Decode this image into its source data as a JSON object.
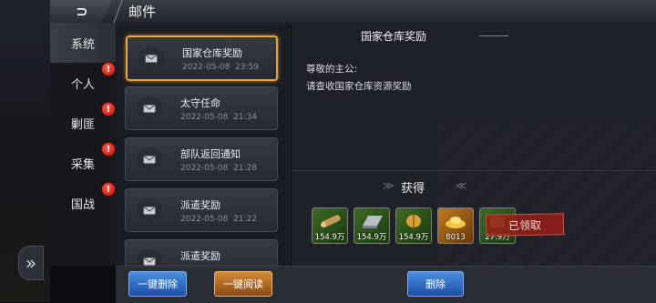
{
  "window": {
    "title": "邮件"
  },
  "tabs": [
    {
      "label": "系统",
      "active": true,
      "alert": false
    },
    {
      "label": "个人",
      "active": false,
      "alert": true
    },
    {
      "label": "剿匪",
      "active": false,
      "alert": true
    },
    {
      "label": "采集",
      "active": false,
      "alert": true
    },
    {
      "label": "国战",
      "active": false,
      "alert": true
    }
  ],
  "mails": [
    {
      "title": "国家仓库奖励",
      "date": "2022-05-08",
      "time": "23:59",
      "selected": true
    },
    {
      "title": "太守任命",
      "date": "2022-05-08",
      "time": "21:34",
      "selected": false
    },
    {
      "title": "部队返回通知",
      "date": "2022-05-08",
      "time": "21:28",
      "selected": false
    },
    {
      "title": "派遣奖励",
      "date": "2022-05-08",
      "time": "21:22",
      "selected": false
    },
    {
      "title": "派遣奖励",
      "date": "",
      "time": "",
      "selected": false
    }
  ],
  "content": {
    "title": "国家仓库奖励",
    "greeting": "尊敬的主公:",
    "body": "请查收国家仓库资源奖励",
    "rewards_label": "获得",
    "claimed_label": "已领取",
    "rewards": [
      {
        "icon": "wood-icon",
        "qty": "154.9万",
        "frame": "green"
      },
      {
        "icon": "iron-icon",
        "qty": "154.9万",
        "frame": "green"
      },
      {
        "icon": "grain-icon",
        "qty": "154.9万",
        "frame": "green"
      },
      {
        "icon": "gold-ingot-icon",
        "qty": "8013",
        "frame": "gold"
      },
      {
        "icon": "resource-icon",
        "qty": "27.9万",
        "frame": "green"
      }
    ]
  },
  "buttons": {
    "delete_all": "一键删除",
    "read_all": "一键阅读",
    "delete": "删除"
  },
  "colors": {
    "selected_border": "#e6a53a",
    "alert_red": "#d3241b",
    "button_blue": "#2f6fc9",
    "button_orange": "#c07a2a"
  }
}
